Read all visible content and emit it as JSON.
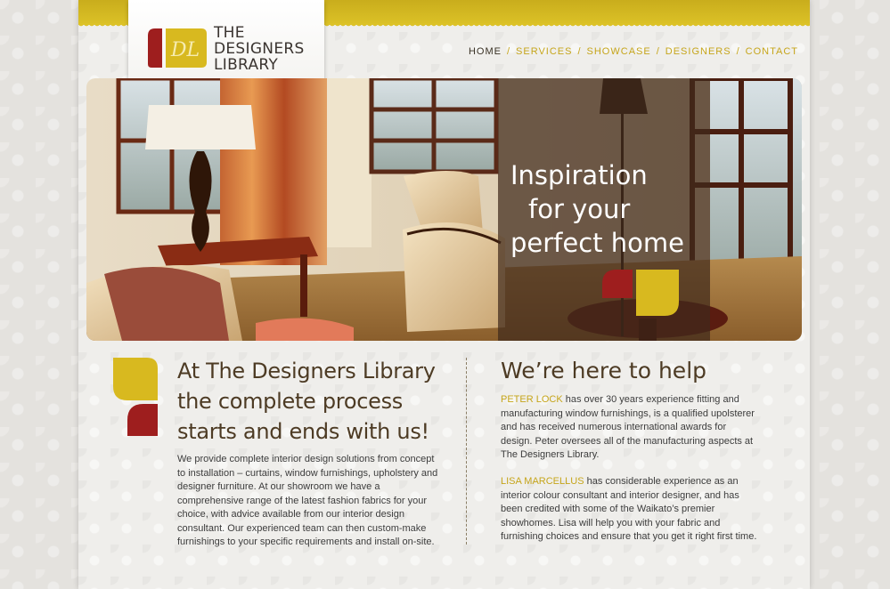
{
  "brand": {
    "line1": "THE",
    "line2": "DESIGNERS",
    "line3": "LIBRARY",
    "monogram": "DL",
    "colors": {
      "gold": "#d8b91f",
      "red": "#9e1e1e",
      "brown": "#4d3b24",
      "nav_gold": "#c6a51a"
    }
  },
  "nav": {
    "items": [
      {
        "label": "HOME",
        "active": true
      },
      {
        "label": "SERVICES",
        "active": false
      },
      {
        "label": "SHOWCASE",
        "active": false
      },
      {
        "label": "DESIGNERS",
        "active": false
      },
      {
        "label": "CONTACT",
        "active": false
      }
    ],
    "separator": "/"
  },
  "hero": {
    "tagline_line1": "Inspiration",
    "tagline_line2": "for your",
    "tagline_line3": "perfect home"
  },
  "intro": {
    "heading_line1": "At The Designers Library",
    "heading_line2": "the complete process",
    "heading_line3": "starts and ends with us!",
    "body": "We provide complete interior design solutions from concept to installation – curtains, window furnishings, upholstery and designer furniture. At our showroom we have a comprehensive range of the latest fashion fabrics for your choice, with advice available from our interior design consultant. Our experienced team can then custom-make furnishings to your specific requirements and install on-site."
  },
  "help": {
    "heading": "We’re here to help",
    "people": [
      {
        "name": "PETER LOCK",
        "text": " has over 30 years experience fitting and manufacturing window furnishings, is a qualified upolsterer and has received numerous international awards for design. Peter oversees all of the manufacturing aspects at The Designers Library."
      },
      {
        "name": "LISA MARCELLUS",
        "text": " has considerable experience as an interior colour consultant and interior designer, and has been credited with some of the Waikato’s premier showhomes. Lisa will help you with your fabric and furnishing choices and ensure that you get it right first time."
      }
    ]
  }
}
